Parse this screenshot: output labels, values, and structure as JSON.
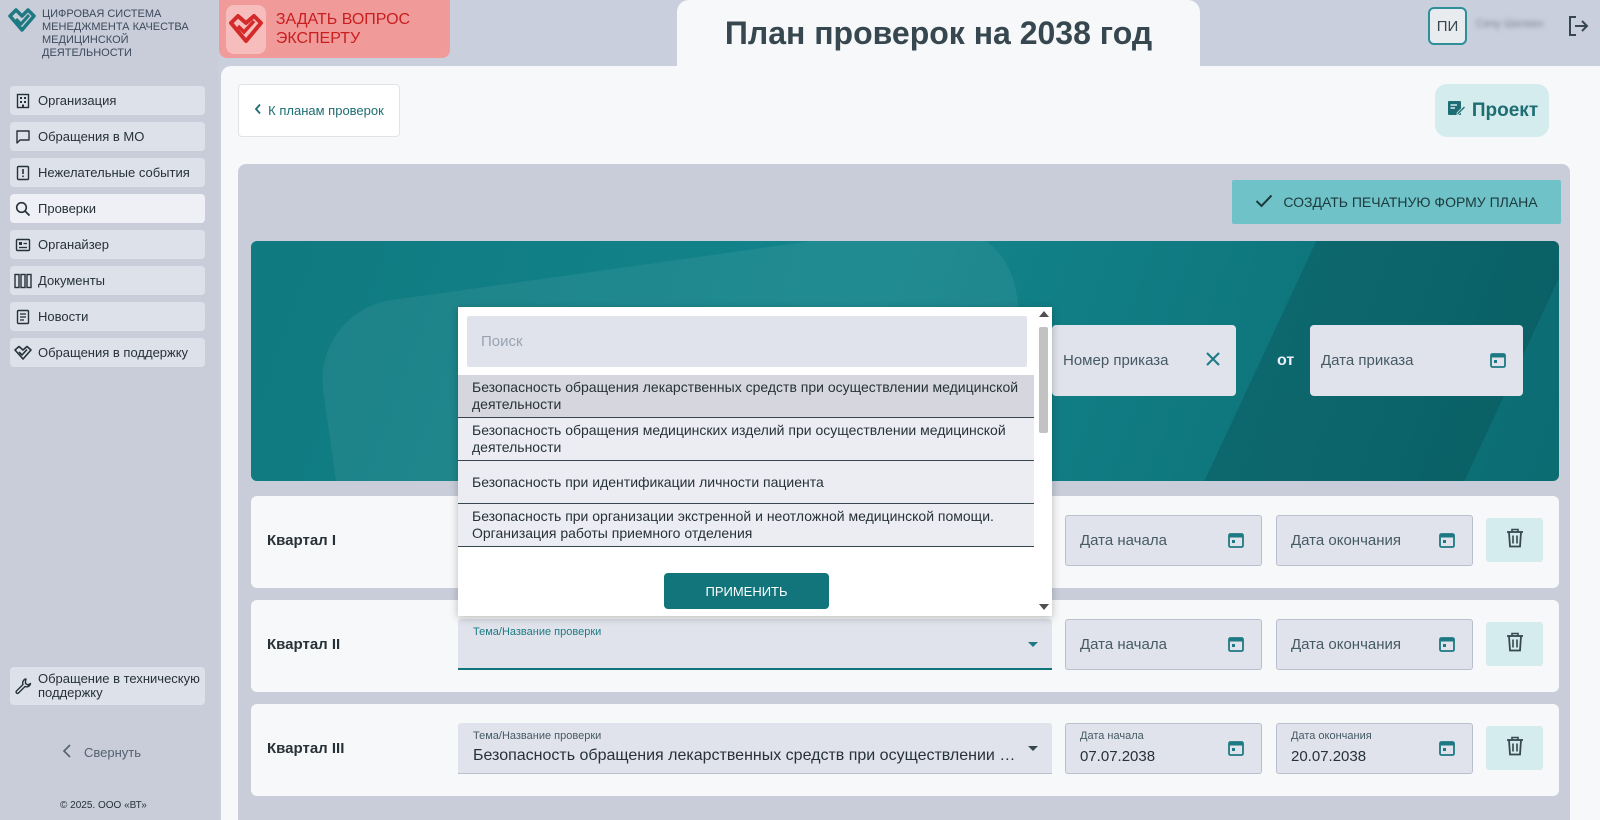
{
  "colors": {
    "accent": "#12757b",
    "accent_light": "#d4ecee",
    "danger": "#c81e1e",
    "danger_bg": "#f19a9a",
    "sidebar_bg": "#c8cdd9"
  },
  "logo": {
    "text": "ЦИФРОВАЯ СИСТЕМА МЕНЕДЖМЕНТА КАЧЕСТВА МЕДИЦИНСКОЙ ДЕЯТЕЛЬНОСТИ",
    "icon": "heart-check-icon"
  },
  "ask_expert": {
    "label": "ЗАДАТЬ ВОПРОС ЭКСПЕРТУ"
  },
  "page": {
    "title": "План проверок на 2038 год"
  },
  "user": {
    "initials": "ПИ",
    "name": "Сечу Шелкен"
  },
  "sidebar": {
    "items": [
      {
        "label": "Организация",
        "icon": "building-icon"
      },
      {
        "label": "Обращения в МО",
        "icon": "chat-icon"
      },
      {
        "label": "Нежелательные события",
        "icon": "alert-book-icon"
      },
      {
        "label": "Проверки",
        "icon": "search-icon"
      },
      {
        "label": "Органайзер",
        "icon": "organizer-icon"
      },
      {
        "label": "Документы",
        "icon": "documents-icon"
      },
      {
        "label": "Новости",
        "icon": "news-icon"
      },
      {
        "label": "Обращения в поддержку",
        "icon": "support-check-icon"
      }
    ],
    "tech_support": "Обращение в техническую поддержку",
    "collapse": "Свернуть",
    "copyright": "© 2025. ООО «ВТ»"
  },
  "toolbar": {
    "back": "К планам проверок",
    "status": "Проект",
    "print": "СОЗДАТЬ ПЕЧАТНУЮ ФОРМУ ПЛАНА"
  },
  "order": {
    "number_placeholder": "Номер приказа",
    "from": "от",
    "date_placeholder": "Дата приказа"
  },
  "dropdown": {
    "search_placeholder": "Поиск",
    "options": [
      "Безопасность обращения лекарственных средств при осуществлении медицинской деятельности",
      "Безопасность обращения медицинских изделий при осуществлении медицинской деятельности",
      "Безопасность при идентификации личности пациента",
      "Безопасность при организации экстренной и неотложной медицинской помощи. Организация работы приемного отделения"
    ],
    "apply": "ПРИМЕНИТЬ"
  },
  "quarters": [
    {
      "label": "Квартал I",
      "start_placeholder": "Дата начала",
      "end_placeholder": "Дата окончания"
    },
    {
      "label": "Квартал II",
      "topic_label": "Тема/Название проверки",
      "start_placeholder": "Дата начала",
      "end_placeholder": "Дата окончания"
    },
    {
      "label": "Квартал III",
      "topic_label": "Тема/Название проверки",
      "topic_value": "Безопасность обращения лекарственных средств при осуществлении медицинской деятельности",
      "start_label": "Дата начала",
      "start_value": "07.07.2038",
      "end_label": "Дата окончания",
      "end_value": "20.07.2038"
    }
  ]
}
